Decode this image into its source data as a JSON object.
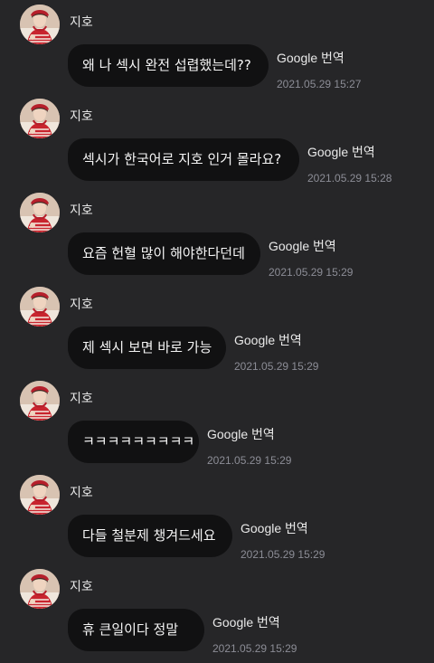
{
  "messages": [
    {
      "sender": "지호",
      "text": "왜 나 섹시 완전 섭렵했는데??",
      "translate_label": "Google 번역",
      "timestamp": "2021.05.29 15:27"
    },
    {
      "sender": "지호",
      "text": "섹시가 한국어로 지호 인거 몰라요?",
      "translate_label": "Google 번역",
      "timestamp": "2021.05.29 15:28"
    },
    {
      "sender": "지호",
      "text": "요즘 헌혈 많이 해야한다던데",
      "translate_label": "Google 번역",
      "timestamp": "2021.05.29 15:29"
    },
    {
      "sender": "지호",
      "text": "제 섹시 보면 바로 가능",
      "translate_label": "Google 번역",
      "timestamp": "2021.05.29 15:29"
    },
    {
      "sender": "지호",
      "text": "ㅋㅋㅋㅋㅋㅋㅋㅋㅋ",
      "translate_label": "Google 번역",
      "timestamp": "2021.05.29 15:29"
    },
    {
      "sender": "지호",
      "text": "다들 철분제 챙겨드세요",
      "translate_label": "Google 번역",
      "timestamp": "2021.05.29 15:29"
    },
    {
      "sender": "지호",
      "text": "휴 큰일이다 정말",
      "translate_label": "Google 번역",
      "timestamp": "2021.05.29 15:29"
    }
  ],
  "colors": {
    "background": "#262628",
    "bubble": "#111112",
    "timestamp": "#8c8d96"
  }
}
